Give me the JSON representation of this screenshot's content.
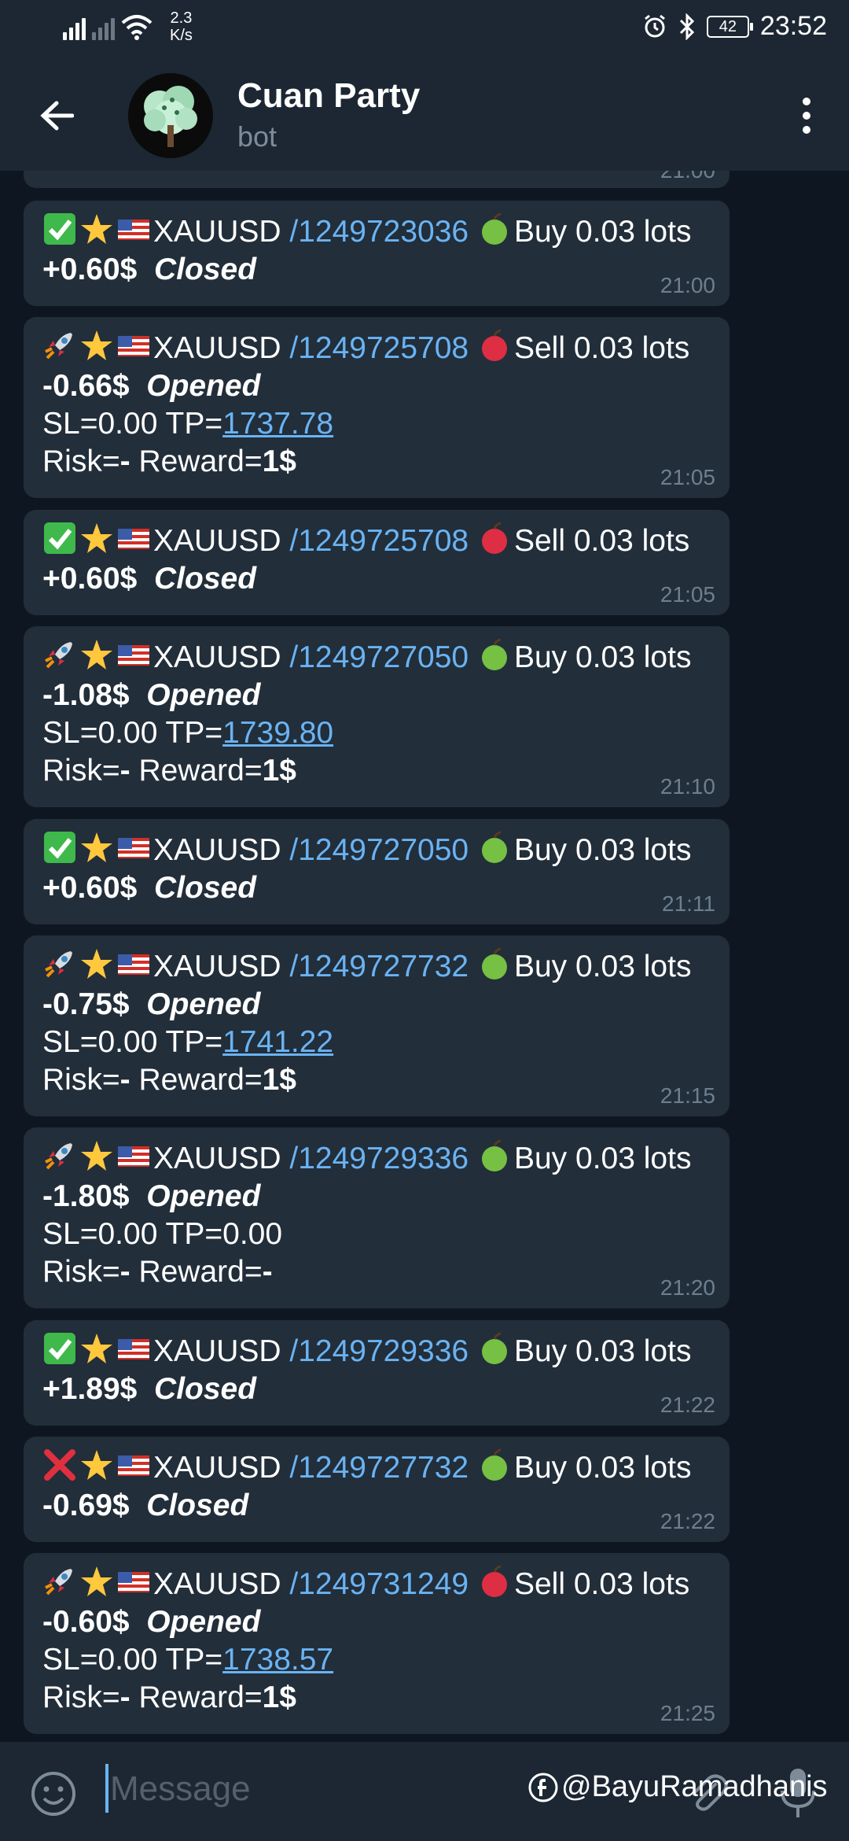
{
  "status_bar": {
    "net_speed_value": "2.3",
    "net_speed_unit": "K/s",
    "battery": "42",
    "time": "23:52",
    "icons": [
      "signal-icon",
      "signal-icon",
      "wifi-icon",
      "alarm-icon",
      "bluetooth-icon",
      "battery-icon"
    ]
  },
  "header": {
    "title": "Cuan Party",
    "subtitle": "bot"
  },
  "colors": {
    "background": "#0e1621",
    "bar": "#1c2733",
    "bubble": "#222e3a",
    "link": "#6ab3f3",
    "time": "#6d7f8f"
  },
  "messages": [
    {
      "status_icon": "check-mark-icon",
      "symbol": "XAUUSD",
      "ticket": "/1249723036",
      "side_icon": "green-apple-icon",
      "side": "Buy 0.03 lots",
      "pnl": "+0.60$",
      "state": "Closed",
      "time": "21:00"
    },
    {
      "status_icon": "rocket-icon",
      "symbol": "XAUUSD",
      "ticket": "/1249725708",
      "side_icon": "red-apple-icon",
      "side": "Sell 0.03 lots",
      "pnl": "-0.66$",
      "state": "Opened",
      "sl": "SL=0.00 TP=",
      "tp": "1737.78",
      "risk": "Risk=",
      "risk_value": "-",
      "reward": " Reward=",
      "reward_value": "1$",
      "time": "21:05"
    },
    {
      "status_icon": "check-mark-icon",
      "symbol": "XAUUSD",
      "ticket": "/1249725708",
      "side_icon": "red-apple-icon",
      "side": "Sell 0.03 lots",
      "pnl": "+0.60$",
      "state": "Closed",
      "time": "21:05"
    },
    {
      "status_icon": "rocket-icon",
      "symbol": "XAUUSD",
      "ticket": "/1249727050",
      "side_icon": "green-apple-icon",
      "side": "Buy 0.03 lots",
      "pnl": "-1.08$",
      "state": "Opened",
      "sl": "SL=0.00 TP=",
      "tp": "1739.80",
      "risk": "Risk=",
      "risk_value": "-",
      "reward": " Reward=",
      "reward_value": "1$",
      "time": "21:10"
    },
    {
      "status_icon": "check-mark-icon",
      "symbol": "XAUUSD",
      "ticket": "/1249727050",
      "side_icon": "green-apple-icon",
      "side": "Buy 0.03 lots",
      "pnl": "+0.60$",
      "state": "Closed",
      "time": "21:11"
    },
    {
      "status_icon": "rocket-icon",
      "symbol": "XAUUSD",
      "ticket": "/1249727732",
      "side_icon": "green-apple-icon",
      "side": "Buy 0.03 lots",
      "pnl": "-0.75$",
      "state": "Opened",
      "sl": "SL=0.00 TP=",
      "tp": "1741.22",
      "risk": "Risk=",
      "risk_value": "-",
      "reward": " Reward=",
      "reward_value": "1$",
      "time": "21:15"
    },
    {
      "status_icon": "rocket-icon",
      "symbol": "XAUUSD",
      "ticket": "/1249729336",
      "side_icon": "green-apple-icon",
      "side": "Buy 0.03 lots",
      "pnl": "-1.80$",
      "state": "Opened",
      "sl": "SL=0.00 TP=0.00",
      "tp": "",
      "risk": "Risk=",
      "risk_value": "-",
      "reward": " Reward=",
      "reward_value": "-",
      "time": "21:20"
    },
    {
      "status_icon": "check-mark-icon",
      "symbol": "XAUUSD",
      "ticket": "/1249729336",
      "side_icon": "green-apple-icon",
      "side": "Buy 0.03 lots",
      "pnl": "+1.89$",
      "state": "Closed",
      "time": "21:22"
    },
    {
      "status_icon": "cross-mark-icon",
      "symbol": "XAUUSD",
      "ticket": "/1249727732",
      "side_icon": "green-apple-icon",
      "side": "Buy 0.03 lots",
      "pnl": "-0.69$",
      "state": "Closed",
      "time": "21:22"
    },
    {
      "status_icon": "rocket-icon",
      "symbol": "XAUUSD",
      "ticket": "/1249731249",
      "side_icon": "red-apple-icon",
      "side": "Sell 0.03 lots",
      "pnl": "-0.60$",
      "state": "Opened",
      "sl": "SL=0.00 TP=",
      "tp": "1738.57",
      "risk": "Risk=",
      "risk_value": "-",
      "reward": " Reward=",
      "reward_value": "1$",
      "time": "21:25"
    }
  ],
  "partial_top_time": "21:00",
  "input": {
    "placeholder": "Message"
  },
  "watermark": "@BayuRamadhanis"
}
